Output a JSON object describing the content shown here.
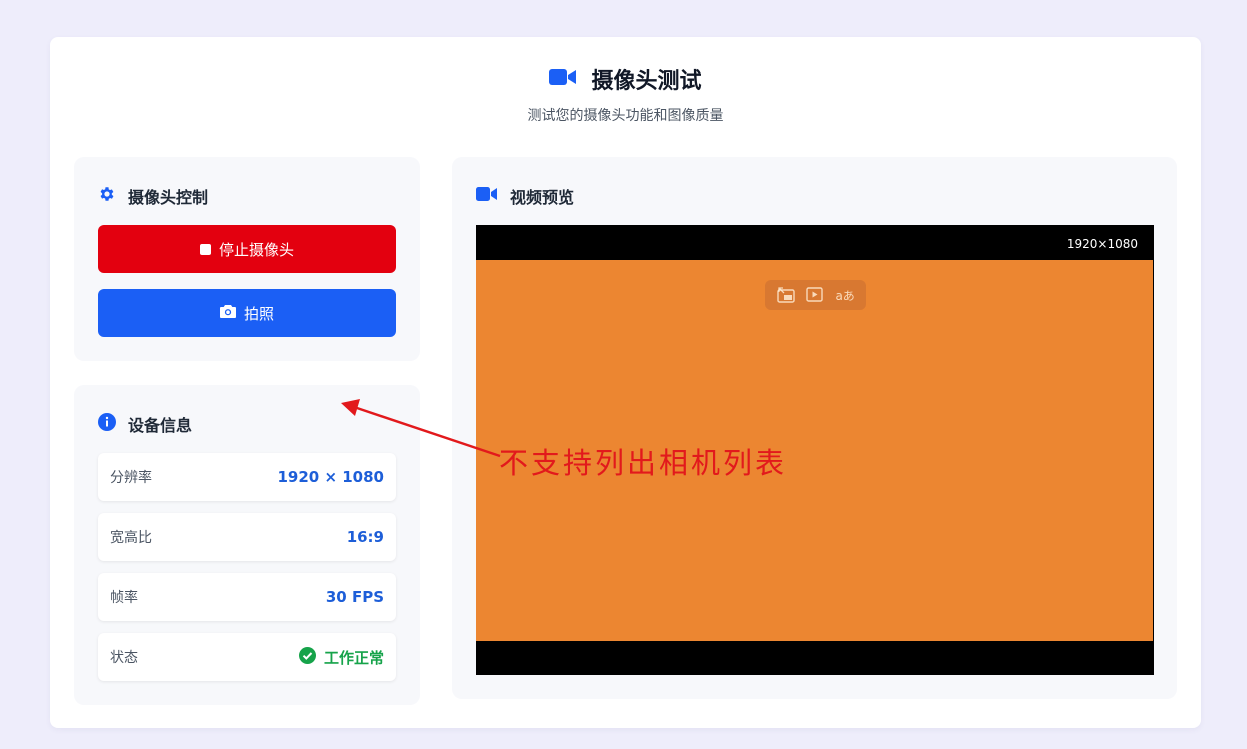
{
  "header": {
    "title": "摄像头测试",
    "subtitle": "测试您的摄像头功能和图像质量"
  },
  "controls": {
    "title": "摄像头控制",
    "stop_label": "停止摄像头",
    "photo_label": "拍照"
  },
  "device_info": {
    "title": "设备信息",
    "rows": [
      {
        "label": "分辨率",
        "value": "1920 × 1080"
      },
      {
        "label": "宽高比",
        "value": "16:9"
      },
      {
        "label": "帧率",
        "value": "30 FPS"
      },
      {
        "label": "状态",
        "value": "工作正常"
      }
    ]
  },
  "video": {
    "title": "视频预览",
    "resolution_badge": "1920×1080",
    "overlay_tools": [
      "picture-in-picture-icon",
      "play-capture-icon",
      "translate-icon"
    ],
    "translate_glyph": "aあ"
  },
  "annotation": {
    "text": "不支持列出相机列表",
    "color": "#e2191c"
  },
  "colors": {
    "accent": "#1b5ff5",
    "stop": "#e3000f",
    "ok": "#16a34a",
    "video_frame": "#ec8631"
  }
}
